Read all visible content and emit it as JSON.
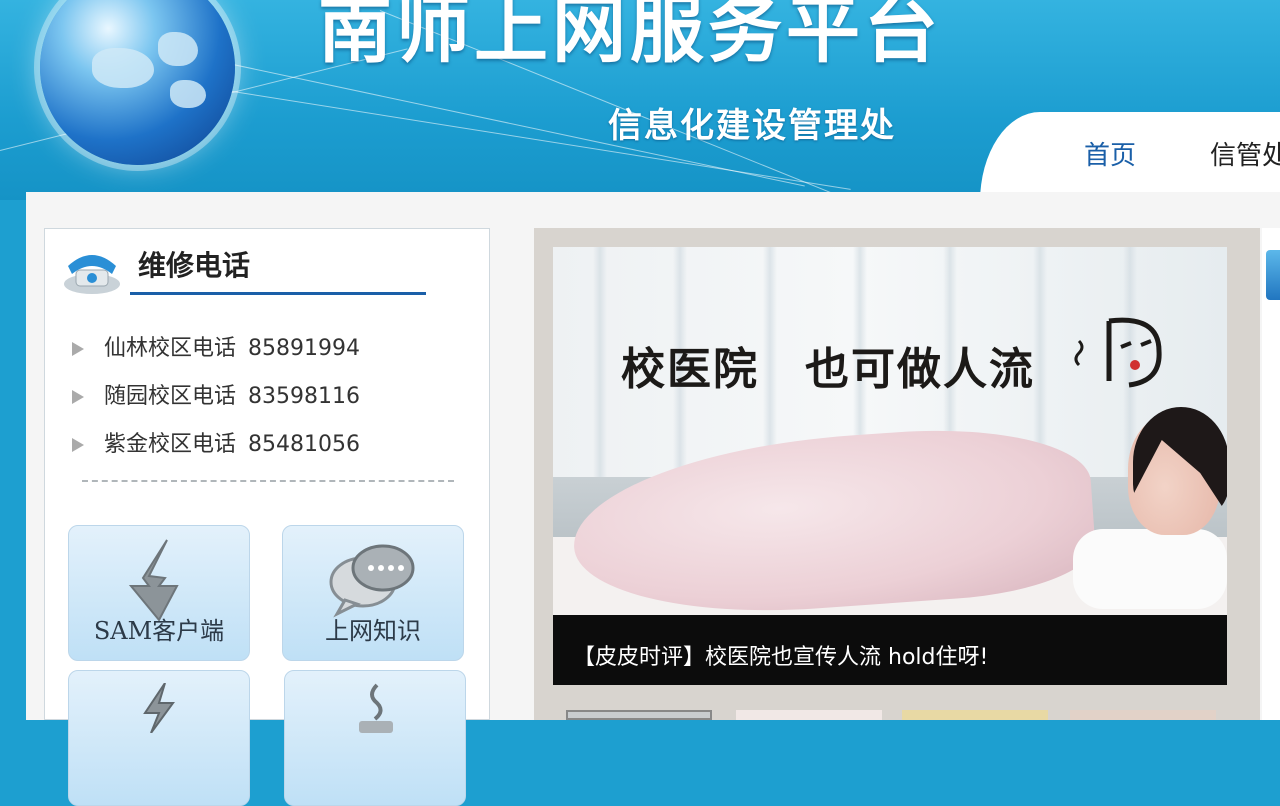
{
  "header": {
    "site_title": "南师上网服务平台",
    "site_subtitle": "信息化建设管理处"
  },
  "nav": {
    "items": [
      {
        "label": "首页"
      },
      {
        "label": "信管处"
      }
    ]
  },
  "repair": {
    "title": "维修电话",
    "phones": [
      {
        "label": "仙林校区电话",
        "number": "85891994"
      },
      {
        "label": "随园校区电话",
        "number": "83598116"
      },
      {
        "label": "紫金校区电话",
        "number": "85481056"
      }
    ]
  },
  "tiles": [
    {
      "label": "SAM客户端",
      "icon": "download-arrow-icon"
    },
    {
      "label": "上网知识",
      "icon": "chat-bubbles-icon"
    },
    {
      "label": "",
      "icon": "lightning-icon"
    },
    {
      "label": "",
      "icon": "cup-icon"
    }
  ],
  "slider": {
    "image_text": "校医院　也可做人流",
    "caption": "【皮皮时评】校医院也宣传人流 hold住呀!"
  },
  "colors": {
    "header_bg": "#1d9fd0",
    "nav_active": "#1a5fa8",
    "caption_bg": "#0c0c0c"
  }
}
